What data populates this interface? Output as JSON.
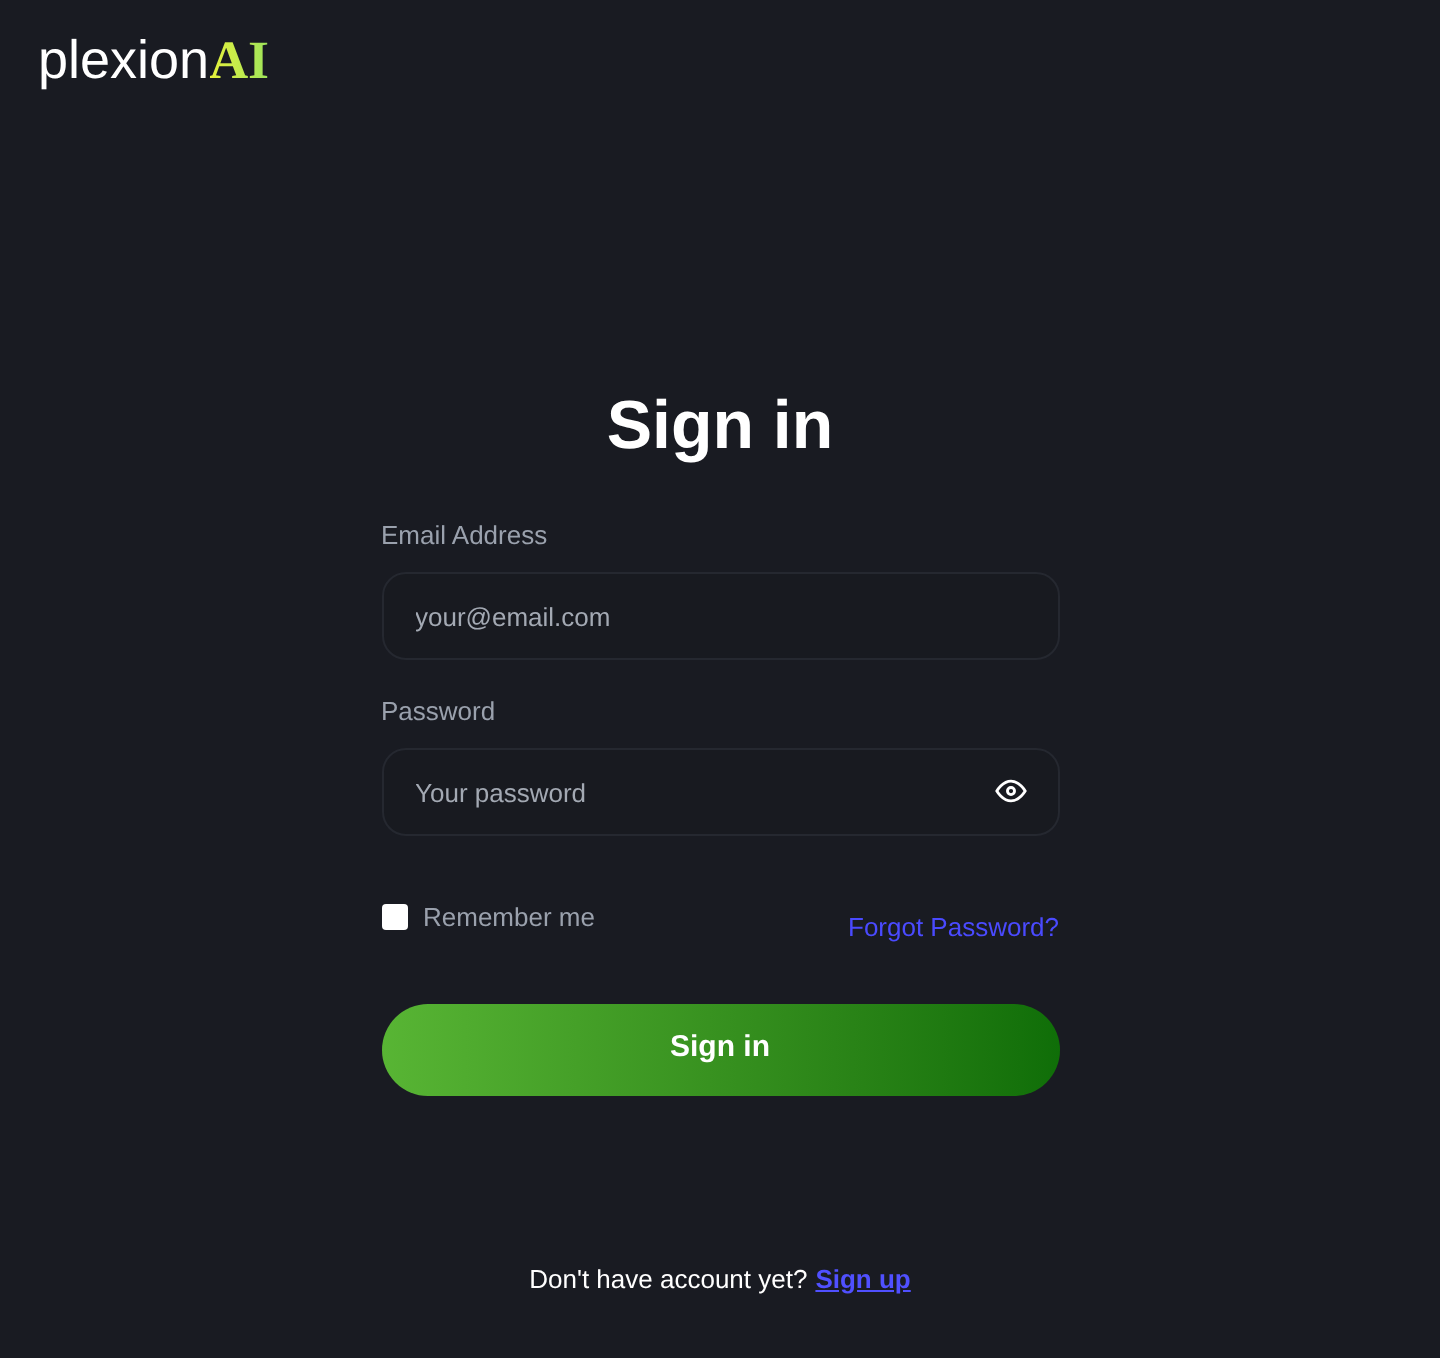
{
  "logo": {
    "name": "plexion",
    "accent": "AI"
  },
  "title": "Sign in",
  "fields": [
    {
      "label": "Email Address",
      "placeholder": "your@email.com",
      "kind": "text"
    },
    {
      "label": "Password",
      "placeholder": "Your password",
      "kind": "password"
    }
  ],
  "remember": {
    "label": "Remember me",
    "checked": false
  },
  "forgot_link": "Forgot Password?",
  "submit": "Sign in",
  "footer": {
    "text": "Don't have account yet?",
    "link": "Sign up"
  }
}
